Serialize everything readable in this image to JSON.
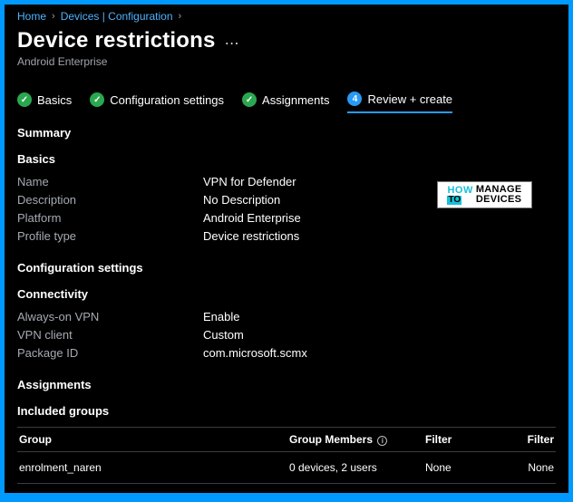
{
  "breadcrumb": {
    "items": [
      {
        "label": "Home"
      },
      {
        "label": "Devices | Configuration"
      }
    ]
  },
  "header": {
    "title": "Device restrictions",
    "subtitle": "Android Enterprise"
  },
  "tabs": [
    {
      "label": "Basics",
      "state": "done"
    },
    {
      "label": "Configuration settings",
      "state": "done"
    },
    {
      "label": "Assignments",
      "state": "done"
    },
    {
      "label": "Review + create",
      "state": "current",
      "step": "4"
    }
  ],
  "summary_label": "Summary",
  "sections": {
    "basics": {
      "title": "Basics",
      "rows": [
        {
          "k": "Name",
          "v": "VPN for Defender"
        },
        {
          "k": "Description",
          "v": "No Description"
        },
        {
          "k": "Platform",
          "v": "Android Enterprise"
        },
        {
          "k": "Profile type",
          "v": "Device restrictions"
        }
      ]
    },
    "config": {
      "title": "Configuration settings",
      "sub": {
        "title": "Connectivity",
        "rows": [
          {
            "k": "Always-on VPN",
            "v": "Enable"
          },
          {
            "k": "VPN client",
            "v": "Custom"
          },
          {
            "k": "Package ID",
            "v": "com.microsoft.scmx"
          }
        ]
      }
    },
    "assignments": {
      "title": "Assignments",
      "included_title": "Included groups",
      "table": {
        "headers": {
          "group": "Group",
          "members": "Group Members",
          "filter": "Filter",
          "filter2": "Filter"
        },
        "rows": [
          {
            "group": "enrolment_naren",
            "members": "0 devices, 2 users",
            "filter": "None",
            "filter2": "None"
          }
        ]
      }
    }
  },
  "watermark": {
    "how": "HOW",
    "to": "TO",
    "manage": "MANAGE",
    "devices": "DEVICES"
  }
}
